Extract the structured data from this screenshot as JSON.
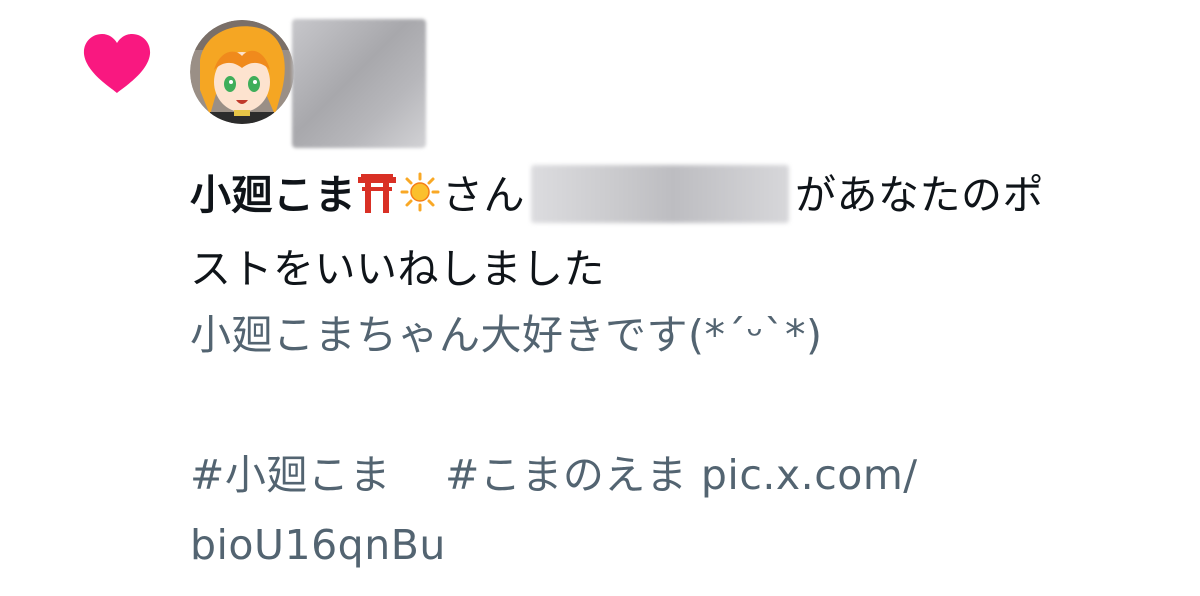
{
  "notification": {
    "type_icon": "heart-icon",
    "heart_color": "#f91880",
    "liker_name": "小廻こま",
    "liker_emojis": [
      "torii-gate-emoji",
      "sun-emoji"
    ],
    "honorific": "さん",
    "action_text_line1": "があなたのポ",
    "action_text_line2": "ストをいいねしました",
    "post_text_line1": "小廻こまちゃん大好きです(*´ᵕ`*)",
    "hashtag1": "#小廻こま",
    "hashtag2": "#こまのえま",
    "link_line1": "pic.x.com/",
    "link_line2": "bioU16qnBu"
  },
  "colors": {
    "primary_text": "#0f1419",
    "secondary_text": "#536471",
    "heart": "#f91880"
  }
}
